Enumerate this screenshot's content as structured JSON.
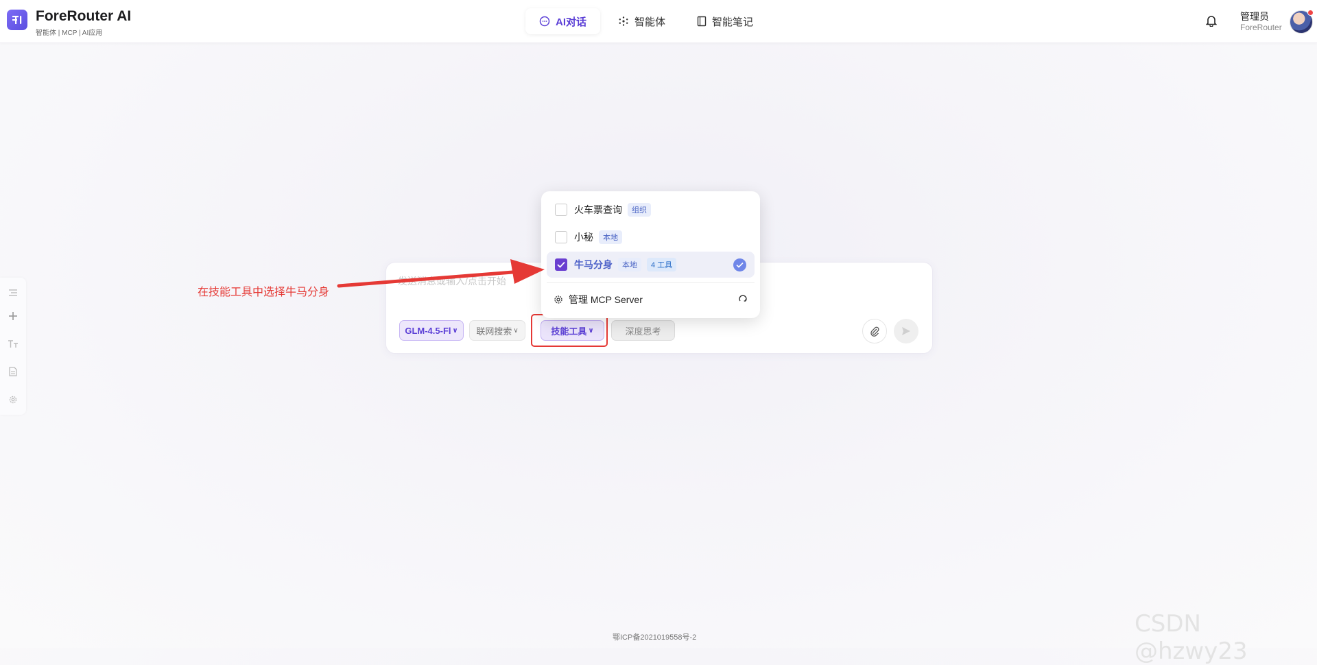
{
  "header": {
    "brand_title": "ForeRouter AI",
    "brand_subtitle": "智能体 | MCP | AI应用",
    "nav": [
      {
        "label": "AI对话",
        "icon": "chat-bubble-icon",
        "active": true
      },
      {
        "label": "智能体",
        "icon": "sparkle-icon",
        "active": false
      },
      {
        "label": "智能笔记",
        "icon": "notebook-icon",
        "active": false
      }
    ],
    "user_name": "管理员",
    "user_org": "ForeRouter"
  },
  "chat": {
    "placeholder": "发送消息或输入/点击开始",
    "model_label": "GLM-4.5-Fl",
    "search_label": "联网搜索",
    "skill_label": "技能工具",
    "deep_label": "深度思考"
  },
  "dropdown": {
    "items": [
      {
        "label": "火车票查询",
        "tag": "组织",
        "checked": false
      },
      {
        "label": "小秘",
        "tag": "本地",
        "checked": false
      },
      {
        "label": "牛马分身",
        "tag": "本地",
        "tool_tag": "4 工具",
        "checked": true
      }
    ],
    "manage_label": "管理 MCP Server"
  },
  "annotation": {
    "text": "在技能工具中选择牛马分身",
    "color": "#e53935"
  },
  "footer": {
    "icp": "鄂ICP备2021019558号-2"
  },
  "watermark": "CSDN @hzwy23",
  "colors": {
    "accent": "#5b3fd6",
    "annotation_red": "#e53935"
  }
}
